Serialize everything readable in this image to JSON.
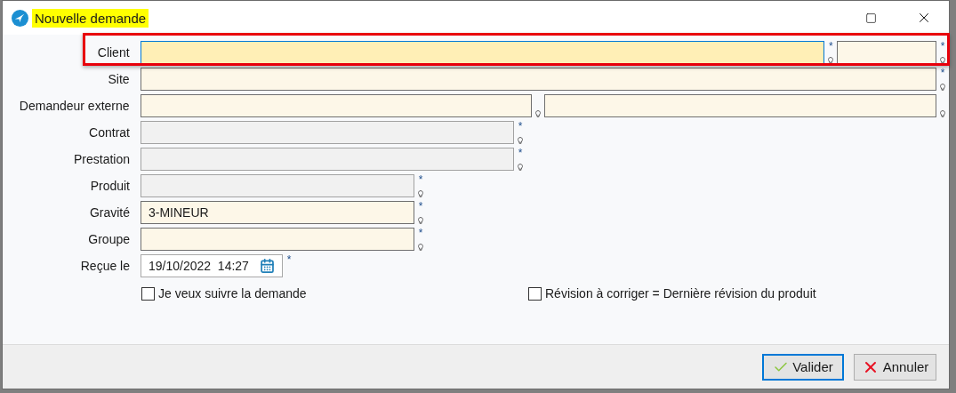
{
  "window": {
    "title": "Nouvelle demande",
    "title_highlighted": true
  },
  "rows": [
    {
      "label": "Client",
      "highlighted": true,
      "fields": [
        {
          "kind": "long",
          "focused": true,
          "disabled": false,
          "required": "*",
          "lookup": true
        },
        {
          "kind": "code",
          "focused": false,
          "disabled": false,
          "required": "*",
          "lookup": true
        }
      ]
    },
    {
      "label": "Site",
      "highlighted": false,
      "fields": [
        {
          "kind": "full",
          "focused": false,
          "disabled": false,
          "required": "*",
          "lookup": true
        }
      ]
    },
    {
      "label": "Demandeur externe",
      "highlighted": false,
      "fields": [
        {
          "kind": "half",
          "focused": false,
          "disabled": false,
          "lookup": true
        },
        {
          "kind": "half",
          "focused": false,
          "disabled": false,
          "lookup": true
        }
      ]
    },
    {
      "label": "Contrat",
      "highlighted": false,
      "fields": [
        {
          "kind": "medium",
          "focused": false,
          "disabled": true,
          "required": "*",
          "lookup": true
        }
      ]
    },
    {
      "label": "Prestation",
      "highlighted": false,
      "fields": [
        {
          "kind": "medium",
          "focused": false,
          "disabled": true,
          "required": "*",
          "lookup": true
        }
      ]
    },
    {
      "label": "Produit",
      "highlighted": false,
      "fields": [
        {
          "kind": "short",
          "focused": false,
          "disabled": true,
          "required": "*",
          "lookup": true
        }
      ]
    },
    {
      "label": "Gravité",
      "highlighted": false,
      "fields": [
        {
          "kind": "short",
          "focused": false,
          "disabled": false,
          "value": "3-MINEUR",
          "required": "*",
          "lookup": true
        }
      ]
    },
    {
      "label": "Groupe",
      "highlighted": false,
      "fields": [
        {
          "kind": "short",
          "focused": false,
          "disabled": false,
          "required": "*",
          "lookup": true
        }
      ]
    },
    {
      "label": "Reçue le",
      "highlighted": false,
      "fields": [
        {
          "kind": "date",
          "focused": false,
          "disabled": false,
          "value": "19/10/2022  14:27",
          "required": "*",
          "lookup": false
        }
      ]
    }
  ],
  "checkboxes": [
    {
      "label": "Je veux suivre la demande",
      "checked": false
    },
    {
      "label": "Révision à corriger = Dernière révision du produit",
      "checked": false
    }
  ],
  "buttons": [
    {
      "label": "Valider",
      "kind": "confirm",
      "default": true
    },
    {
      "label": "Annuler",
      "kind": "cancel",
      "default": false
    }
  ]
}
